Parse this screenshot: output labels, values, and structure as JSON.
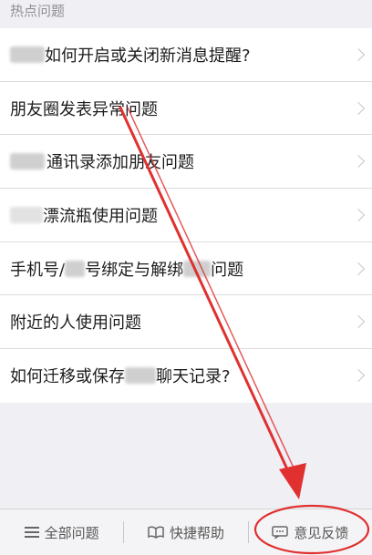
{
  "section_header": "热点问题",
  "rows": [
    {
      "prefix_blur": true,
      "text": "如何开启或关闭新消息提醒?"
    },
    {
      "prefix_blur": false,
      "text": "朋友圈发表异常问题"
    },
    {
      "prefix_blur": true,
      "text": "通讯录添加朋友问题"
    },
    {
      "prefix_blur": true,
      "text": "漂流瓶使用问题"
    },
    {
      "prefix_blur": false,
      "text": "手机号/",
      "mid": "号绑定与解绑",
      "end": "问题"
    },
    {
      "prefix_blur": false,
      "text": "附近的人使用问题"
    },
    {
      "prefix_blur": false,
      "text": "如何迁移或保存",
      "end": "聊天记录?"
    }
  ],
  "toolbar": {
    "all_questions": "全部问题",
    "quick_help": "快捷帮助",
    "feedback": "意见反馈"
  },
  "colors": {
    "annotation": "#e03030",
    "background": "#efeff4"
  },
  "icons": [
    "list-icon",
    "book-icon",
    "chat-bubble-icon",
    "chevron-right-icon"
  ]
}
